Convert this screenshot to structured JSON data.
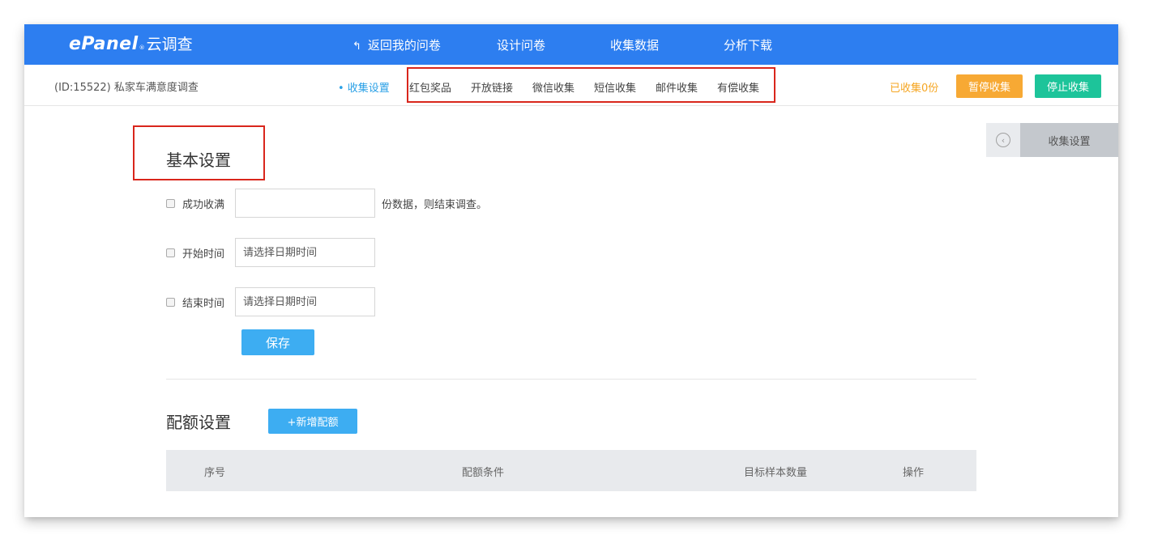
{
  "header": {
    "logo_brand": "ePanel",
    "logo_reg": "®",
    "logo_sub": "云调查",
    "nav": {
      "back": "返回我的问卷",
      "design": "设计问卷",
      "collect": "收集数据",
      "analyze": "分析下载"
    }
  },
  "subbar": {
    "survey_id": "(ID:15522) 私家车满意度调查",
    "tabs": {
      "settings": "• 收集设置",
      "red_packet": "红包奖品",
      "open_link": "开放链接",
      "wechat": "微信收集",
      "sms": "短信收集",
      "email": "邮件收集",
      "paid": "有偿收集"
    },
    "collected": "已收集0份",
    "pause": "暂停收集",
    "stop": "停止收集"
  },
  "side_panel": {
    "collapse_icon": "chevron-left-circle",
    "tab_label": "收集设置"
  },
  "basic": {
    "title": "基本设置",
    "quota_label": "成功收满",
    "quota_value": "",
    "quota_suffix": "份数据，则结束调查。",
    "start_label": "开始时间",
    "start_placeholder": "请选择日期时间",
    "end_label": "结束时间",
    "end_placeholder": "请选择日期时间",
    "save": "保存"
  },
  "quota": {
    "title": "配额设置",
    "add": "+新增配额",
    "columns": {
      "index": "序号",
      "condition": "配额条件",
      "target": "目标样本数量",
      "action": "操作"
    }
  },
  "colors": {
    "topbar": "#2d7ef0",
    "active_tab": "#2aa0e6",
    "pause": "#f7a934",
    "stop": "#1dc49a",
    "primary_button": "#3dadf2",
    "highlight_box": "#d9261c"
  }
}
